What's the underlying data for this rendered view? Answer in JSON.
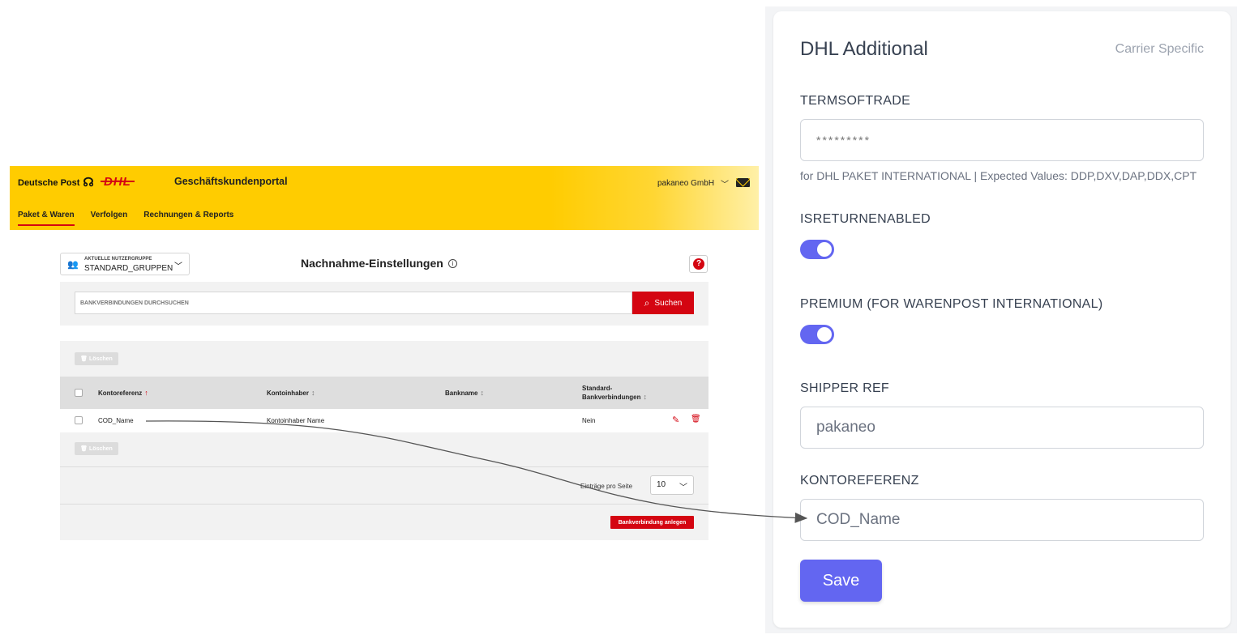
{
  "portal": {
    "brand_dp": "Deutsche Post",
    "brand_dhl": "DHL",
    "title": "Geschäftskundenportal",
    "account": "pakaneo GmbH",
    "nav": [
      "Paket & Waren",
      "Verfolgen",
      "Rechnungen & Reports"
    ],
    "group_label": "AKTUELLE NUTZERGRUPPE",
    "group_value": "STANDARD_GRUPPEN",
    "heading": "Nachnahme-Einstellungen",
    "search_placeholder": "BANKVERBINDUNGEN DURCHSUCHEN",
    "search_button": "Suchen",
    "delete_label": "Löschen",
    "columns": [
      "Kontoreferenz",
      "Kontoinhaber",
      "Bankname",
      "Standard-",
      "Bankverbindungen"
    ],
    "row": {
      "kontoreferenz": "COD_Name",
      "kontoinhaber": "Kontoinhaber Name",
      "bankname": "",
      "standard": "Nein"
    },
    "per_page_label": "Einträge pro Seite",
    "per_page_value": "10",
    "create_button": "Bankverbindung anlegen"
  },
  "form": {
    "title": "DHL Additional",
    "subtitle": "Carrier Specific",
    "fields": {
      "termsoftrade_label": "TERMSOFTRADE",
      "termsoftrade_value": "*********",
      "termsoftrade_help": "for DHL PAKET INTERNATIONAL | Expected Values: DDP,DXV,DAP,DDX,CPT",
      "isreturnenabled_label": "ISRETURNENABLED",
      "premium_label": "PREMIUM (FOR WARENPOST INTERNATIONAL)",
      "shipperref_label": "SHIPPER REF",
      "shipperref_value": "pakaneo",
      "kontoreferenz_label": "KONTOREFERENZ",
      "kontoreferenz_value": "COD_Name"
    },
    "isreturnenabled_on": true,
    "premium_on": true,
    "save_label": "Save",
    "accent_color": "#6366f1"
  },
  "colors": {
    "dhl_yellow": "#ffcc00",
    "dhl_red": "#d40511"
  }
}
